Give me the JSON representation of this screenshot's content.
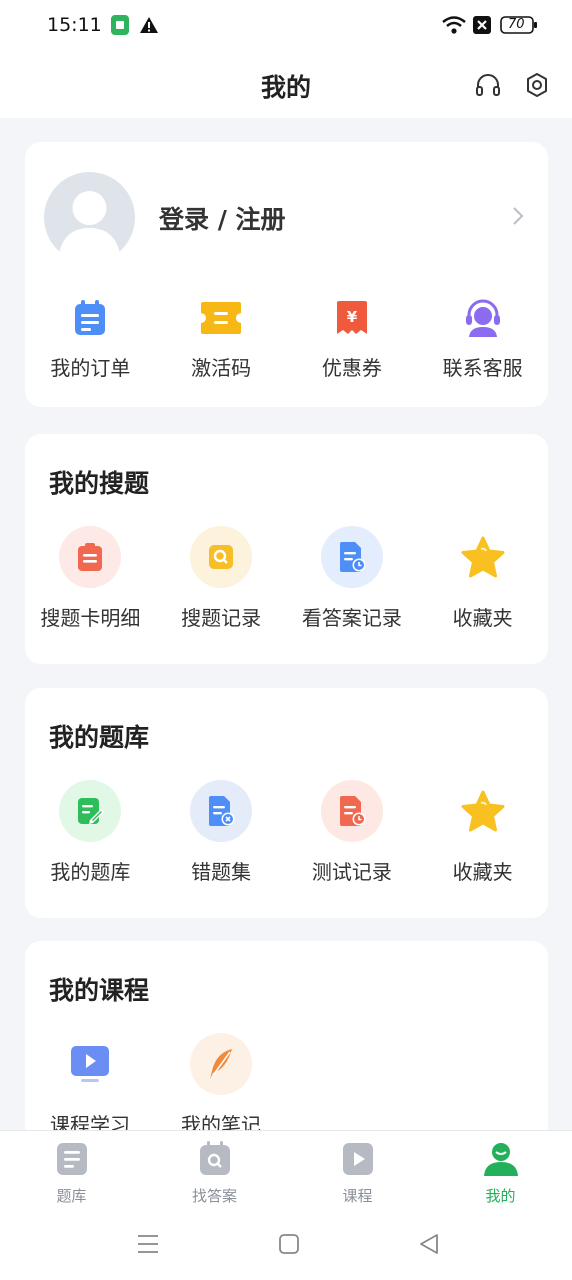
{
  "status": {
    "time": "15:11",
    "battery": "70"
  },
  "header": {
    "title": "我的"
  },
  "profile": {
    "login_label": "登录 / 注册",
    "shortcuts": [
      {
        "label": "我的订单",
        "icon": "order-icon"
      },
      {
        "label": "激活码",
        "icon": "ticket-icon"
      },
      {
        "label": "优惠券",
        "icon": "coupon-icon"
      },
      {
        "label": "联系客服",
        "icon": "customer-service-icon"
      }
    ]
  },
  "search_section": {
    "title": "我的搜题",
    "items": [
      {
        "label": "搜题卡明细",
        "icon": "clipboard-icon"
      },
      {
        "label": "搜题记录",
        "icon": "search-record-icon"
      },
      {
        "label": "看答案记录",
        "icon": "answer-record-icon"
      },
      {
        "label": "收藏夹",
        "icon": "star-icon"
      }
    ]
  },
  "bank_section": {
    "title": "我的题库",
    "items": [
      {
        "label": "我的题库",
        "icon": "edit-doc-icon"
      },
      {
        "label": "错题集",
        "icon": "wrong-doc-icon"
      },
      {
        "label": "测试记录",
        "icon": "test-record-icon"
      },
      {
        "label": "收藏夹",
        "icon": "star-icon"
      }
    ]
  },
  "course_section": {
    "title": "我的课程",
    "items": [
      {
        "label": "课程学习",
        "icon": "video-icon"
      },
      {
        "label": "我的笔记",
        "icon": "feather-icon"
      }
    ]
  },
  "tabbar": {
    "items": [
      {
        "label": "题库",
        "icon": "question-bank-icon"
      },
      {
        "label": "找答案",
        "icon": "find-answer-icon"
      },
      {
        "label": "课程",
        "icon": "course-play-icon"
      },
      {
        "label": "我的",
        "icon": "profile-icon"
      }
    ],
    "active": "我的"
  },
  "colors": {
    "accent": "#22b05a",
    "background": "#f3f5f8"
  }
}
